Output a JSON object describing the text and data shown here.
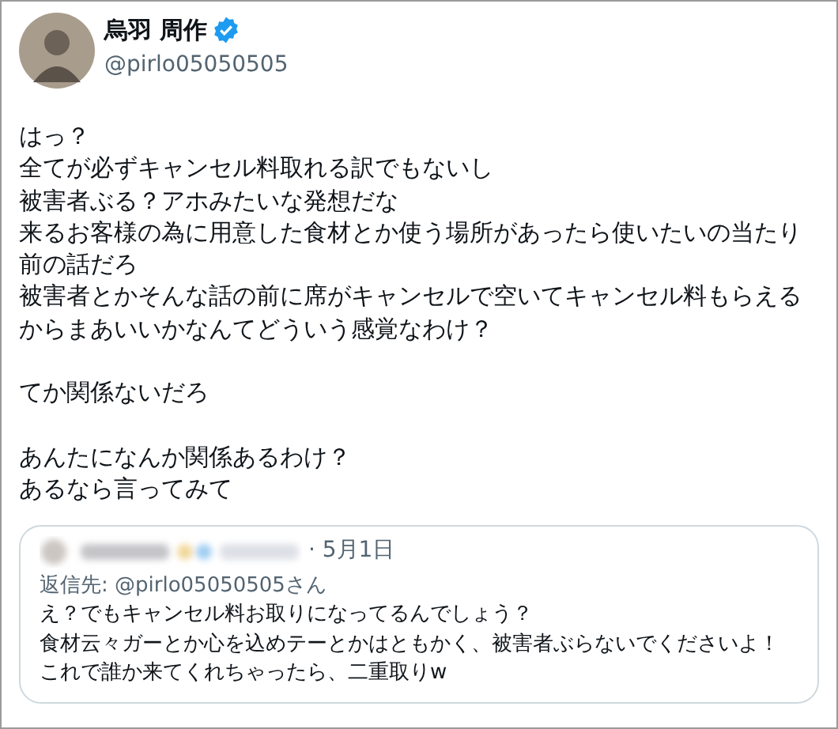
{
  "author": {
    "name": "烏羽 周作",
    "verified": true,
    "handle": "@pirlo05050505"
  },
  "paragraphs": [
    [
      "はっ？",
      "全てが必ずキャンセル料取れる訳でもないし",
      "被害者ぶる？アホみたいな発想だな",
      "来るお客様の為に用意した食材とか使う場所があったら使いたいの当たり",
      "前の話だろ",
      "被害者とかそんな話の前に席がキャンセルで空いてキャンセル料もらえる",
      "からまあいいかなんてどういう感覚なわけ？"
    ],
    [
      "てか関係ないだろ"
    ],
    [
      "あんたになんか関係あるわけ？",
      "あるなら言ってみて"
    ]
  ],
  "quoted": {
    "date": "· 5月1日",
    "reply_to": "返信先: @pirlo05050505さん",
    "body": [
      "え？でもキャンセル料お取りになってるんでしょう？",
      "食材云々ガーとか心を込めテーとかはともかく、被害者ぶらないでくださいよ！",
      "これで誰か来てくれちゃったら、二重取りw"
    ]
  }
}
